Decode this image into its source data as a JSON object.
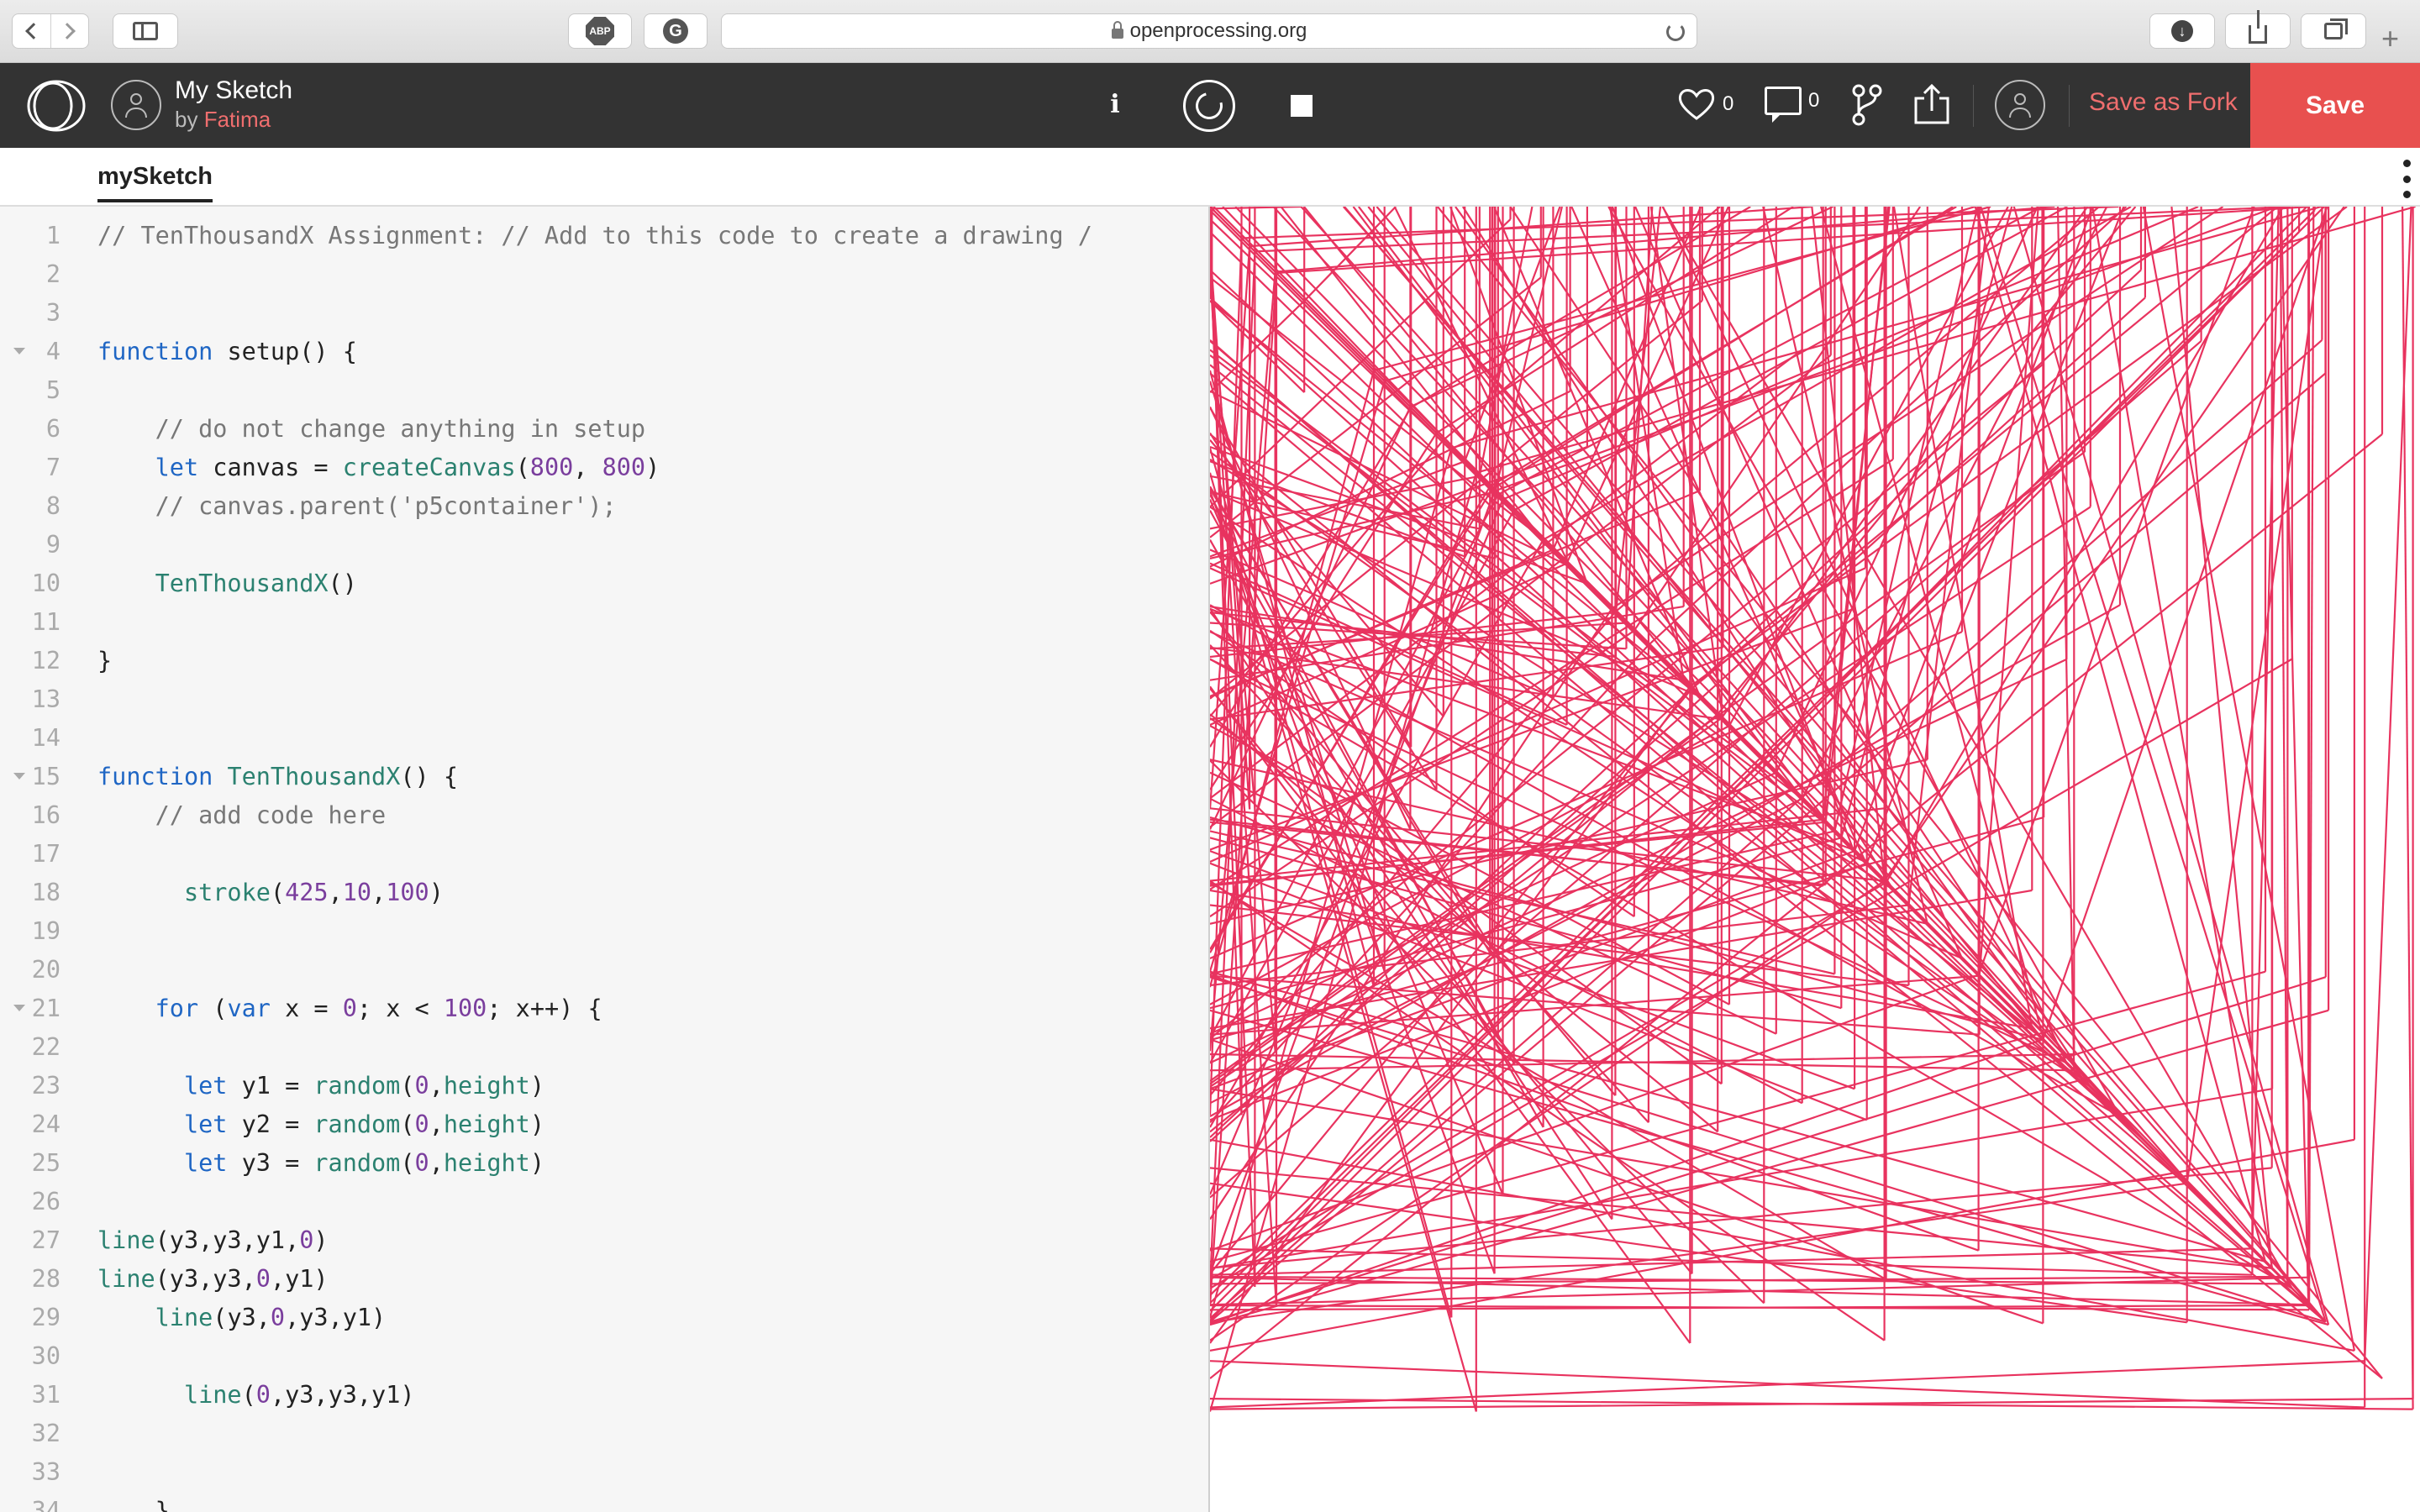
{
  "browser": {
    "url": "openprocessing.org",
    "abp_label": "ABP",
    "grammarly_label": "G"
  },
  "app": {
    "sketch_title": "My Sketch",
    "by_label": "by",
    "author": "Fatima",
    "info_label": "i",
    "likes_count": "0",
    "comments_count": "0",
    "save_as_fork_label": "Save as Fork",
    "save_label": "Save"
  },
  "tabs": [
    {
      "label": "mySketch"
    }
  ],
  "editor": {
    "lines": [
      {
        "n": "1",
        "text": "// TenThousandX Assignment: // Add to this code to create a drawing /",
        "fold": false
      },
      {
        "n": "2",
        "text": "",
        "fold": false
      },
      {
        "n": "3",
        "text": "",
        "fold": false
      },
      {
        "n": "4",
        "text": "function setup() {",
        "fold": true
      },
      {
        "n": "5",
        "text": "",
        "fold": false
      },
      {
        "n": "6",
        "text": "    // do not change anything in setup",
        "fold": false
      },
      {
        "n": "7",
        "text": "    let canvas = createCanvas(800, 800)",
        "fold": false
      },
      {
        "n": "8",
        "text": "    // canvas.parent('p5container');",
        "fold": false
      },
      {
        "n": "9",
        "text": "",
        "fold": false
      },
      {
        "n": "10",
        "text": "    TenThousandX()",
        "fold": false
      },
      {
        "n": "11",
        "text": "",
        "fold": false
      },
      {
        "n": "12",
        "text": "}",
        "fold": false
      },
      {
        "n": "13",
        "text": "",
        "fold": false
      },
      {
        "n": "14",
        "text": "",
        "fold": false
      },
      {
        "n": "15",
        "text": "function TenThousandX() {",
        "fold": true
      },
      {
        "n": "16",
        "text": "    // add code here",
        "fold": false
      },
      {
        "n": "17",
        "text": "",
        "fold": false
      },
      {
        "n": "18",
        "text": "      stroke(425,10,100)",
        "fold": false
      },
      {
        "n": "19",
        "text": "",
        "fold": false
      },
      {
        "n": "20",
        "text": "",
        "fold": false
      },
      {
        "n": "21",
        "text": "    for (var x = 0; x < 100; x++) {",
        "fold": true
      },
      {
        "n": "22",
        "text": "",
        "fold": false
      },
      {
        "n": "23",
        "text": "      let y1 = random(0,height)",
        "fold": false
      },
      {
        "n": "24",
        "text": "      let y2 = random(0,height)",
        "fold": false
      },
      {
        "n": "25",
        "text": "      let y3 = random(0,height)",
        "fold": false
      },
      {
        "n": "26",
        "text": "",
        "fold": false
      },
      {
        "n": "27",
        "text": "line(y3,y3,y1,0)",
        "fold": false
      },
      {
        "n": "28",
        "text": "line(y3,y3,0,y1)",
        "fold": false
      },
      {
        "n": "29",
        "text": "    line(y3,0,y3,y1)",
        "fold": false
      },
      {
        "n": "30",
        "text": "",
        "fold": false
      },
      {
        "n": "31",
        "text": "      line(0,y3,y3,y1)",
        "fold": false
      },
      {
        "n": "32",
        "text": "",
        "fold": false
      },
      {
        "n": "33",
        "text": "",
        "fold": false
      },
      {
        "n": "34",
        "text": "    }",
        "fold": false
      }
    ]
  },
  "preview": {
    "stroke_color": "#e8335f",
    "background_color": "#ffffff",
    "line_sets": 100
  },
  "colors": {
    "accent": "#e8504f",
    "header_bg": "#333333",
    "author": "#ef6e6e"
  },
  "icons": {
    "back": "chevron-left-icon",
    "forward": "chevron-right-icon",
    "sidebar": "sidebar-icon",
    "reload": "reload-icon",
    "download": "download-icon",
    "share": "share-icon",
    "tabs": "tabs-icon",
    "logo": "openprocessing-logo",
    "heart": "heart-icon",
    "comment": "comment-icon",
    "fork": "fork-icon",
    "replay": "replay-icon",
    "stop": "stop-icon",
    "more": "more-vertical-icon"
  }
}
